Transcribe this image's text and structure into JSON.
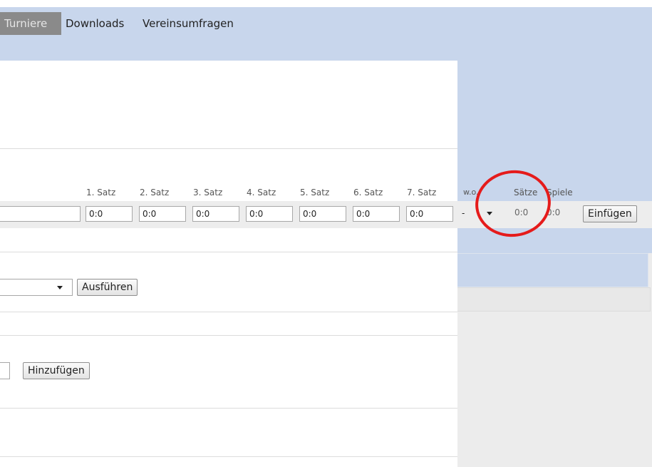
{
  "nav": {
    "items": [
      {
        "label": "Turniere",
        "active": true
      },
      {
        "label": "Downloads"
      },
      {
        "label": "Vereinsumfragen"
      }
    ]
  },
  "score_entry": {
    "headers": [
      "1. Satz",
      "2. Satz",
      "3. Satz",
      "4. Satz",
      "5. Satz",
      "6. Satz",
      "7. Satz",
      "w.o.",
      "Sätze",
      "Spiele"
    ],
    "set_values": [
      "0:0",
      "0:0",
      "0:0",
      "0:0",
      "0:0",
      "0:0",
      "0:0"
    ],
    "player_value": "",
    "wo_selected": "-",
    "saetze_value": "0:0",
    "spiele_value": "0:0",
    "insert_label": "Einfügen"
  },
  "actions": {
    "execute_label": "Ausführen",
    "add_label": "Hinzufügen"
  },
  "colors": {
    "header_band": "#c8d6ec",
    "active_tab": "#8a8a8a",
    "annotation": "#e51b1b"
  }
}
